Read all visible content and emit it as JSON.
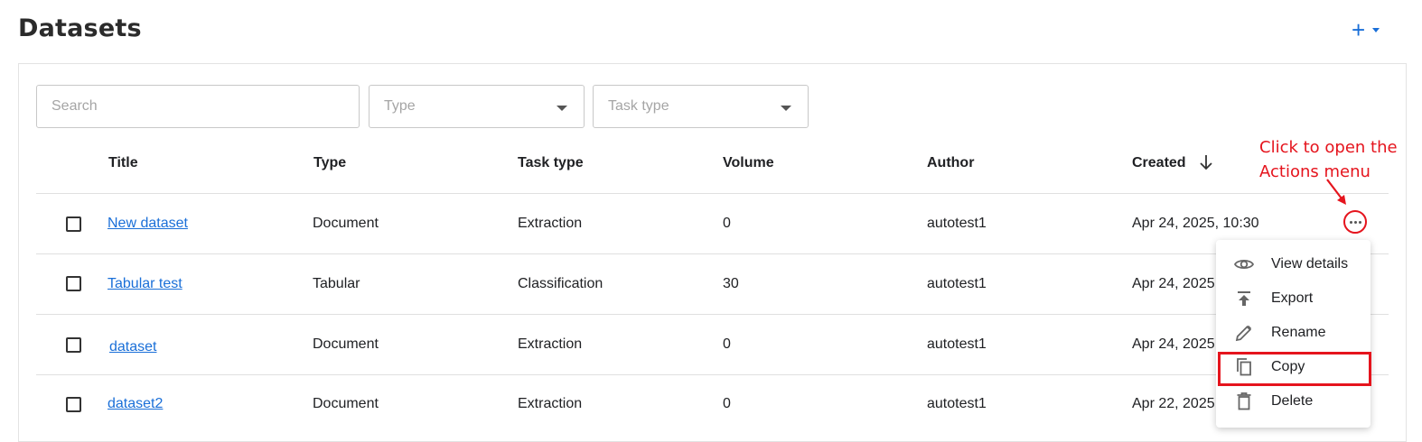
{
  "header": {
    "title": "Datasets",
    "add_label": "+"
  },
  "filters": {
    "search_placeholder": "Search",
    "type_placeholder": "Type",
    "task_type_placeholder": "Task type"
  },
  "table": {
    "columns": [
      "Title",
      "Type",
      "Task type",
      "Volume",
      "Author",
      "Created"
    ],
    "sort": {
      "column": "Created",
      "direction": "descending"
    },
    "rows": [
      {
        "title": "New dataset",
        "type": "Document",
        "task_type": "Extraction",
        "volume": "0",
        "author": "autotest1",
        "created": "Apr 24, 2025, 10:30"
      },
      {
        "title": "Tabular test",
        "type": "Tabular",
        "task_type": "Classification",
        "volume": "30",
        "author": "autotest1",
        "created": "Apr 24, 2025"
      },
      {
        "title": "dataset",
        "type": "Document",
        "task_type": "Extraction",
        "volume": "0",
        "author": "autotest1",
        "created": "Apr 24, 2025"
      },
      {
        "title": "dataset2",
        "type": "Document",
        "task_type": "Extraction",
        "volume": "0",
        "author": "autotest1",
        "created": "Apr 22, 2025"
      }
    ]
  },
  "actions_menu": {
    "items": [
      {
        "label": "View details",
        "icon": "eye-icon"
      },
      {
        "label": "Export",
        "icon": "export-icon"
      },
      {
        "label": "Rename",
        "icon": "pencil-icon"
      },
      {
        "label": "Copy",
        "icon": "copy-icon",
        "highlighted": true
      },
      {
        "label": "Delete",
        "icon": "trash-icon"
      }
    ]
  },
  "annotation": {
    "text": "Click to open the Actions menu"
  },
  "colors": {
    "accent": "#1a6fd8",
    "annotation": "#e5141d"
  }
}
